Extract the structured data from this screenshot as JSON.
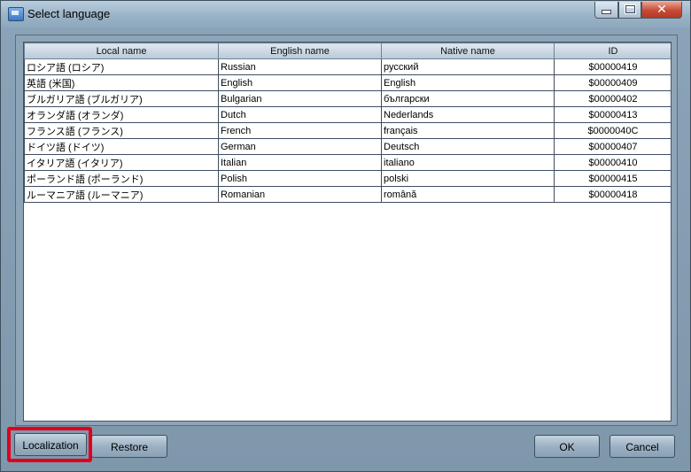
{
  "window": {
    "title": "Select language",
    "controls": {
      "minimize": "",
      "maximize": "",
      "close": "✕"
    }
  },
  "table": {
    "columns": [
      "Local name",
      "English name",
      "Native name",
      "ID"
    ],
    "rows": [
      [
        "ロシア語 (ロシア)",
        "Russian",
        "русский",
        "$00000419"
      ],
      [
        "英語 (米国)",
        "English",
        "English",
        "$00000409"
      ],
      [
        "ブルガリア語 (ブルガリア)",
        "Bulgarian",
        "български",
        "$00000402"
      ],
      [
        "オランダ語 (オランダ)",
        "Dutch",
        "Nederlands",
        "$00000413"
      ],
      [
        "フランス語 (フランス)",
        "French",
        "français",
        "$0000040C"
      ],
      [
        "ドイツ語 (ドイツ)",
        "German",
        "Deutsch",
        "$00000407"
      ],
      [
        "イタリア語 (イタリア)",
        "Italian",
        "italiano",
        "$00000410"
      ],
      [
        "ポーランド語 (ポーランド)",
        "Polish",
        "polski",
        "$00000415"
      ],
      [
        "ルーマニア語 (ルーマニア)",
        "Romanian",
        "română",
        "$00000418"
      ]
    ]
  },
  "buttons": {
    "localization": "Localization",
    "restore": "Restore",
    "ok": "OK",
    "cancel": "Cancel"
  },
  "colors": {
    "highlight": "#e0001b",
    "close_button": "#c74a35"
  }
}
